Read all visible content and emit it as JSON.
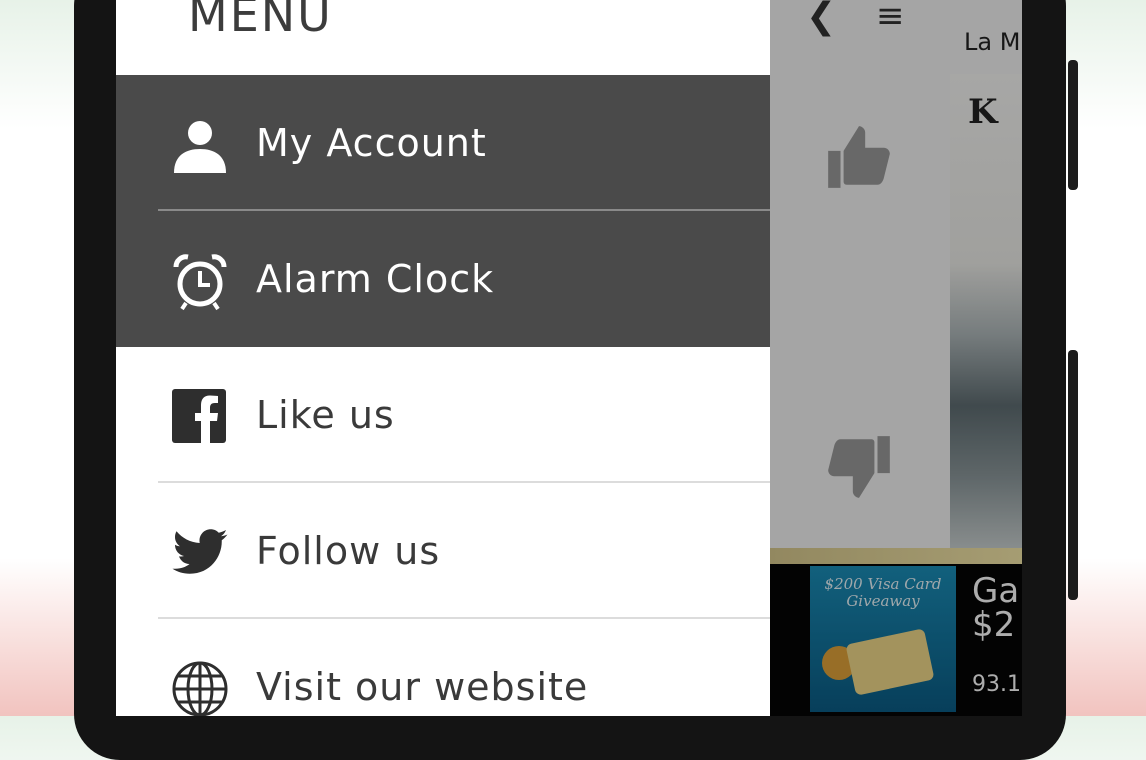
{
  "drawer": {
    "title": "MENU",
    "items": [
      {
        "label": "My Account",
        "icon": "person-icon"
      },
      {
        "label": "Alarm Clock",
        "icon": "alarm-clock-icon"
      },
      {
        "label": "Like us",
        "icon": "facebook-icon"
      },
      {
        "label": "Follow us",
        "icon": "twitter-icon"
      },
      {
        "label": "Visit our website",
        "icon": "globe-icon"
      }
    ]
  },
  "background_app": {
    "partial_text": "La M",
    "logo_text": "K",
    "promo_title": "$200 Visa Card Giveaway",
    "promo_headline_1": "Ga",
    "promo_headline_2": "$2",
    "promo_sub": "93.1"
  },
  "colors": {
    "drawer_dark": "#4a4a4a",
    "drawer_light": "#ffffff",
    "promo_blue": "#1b8eb8"
  }
}
